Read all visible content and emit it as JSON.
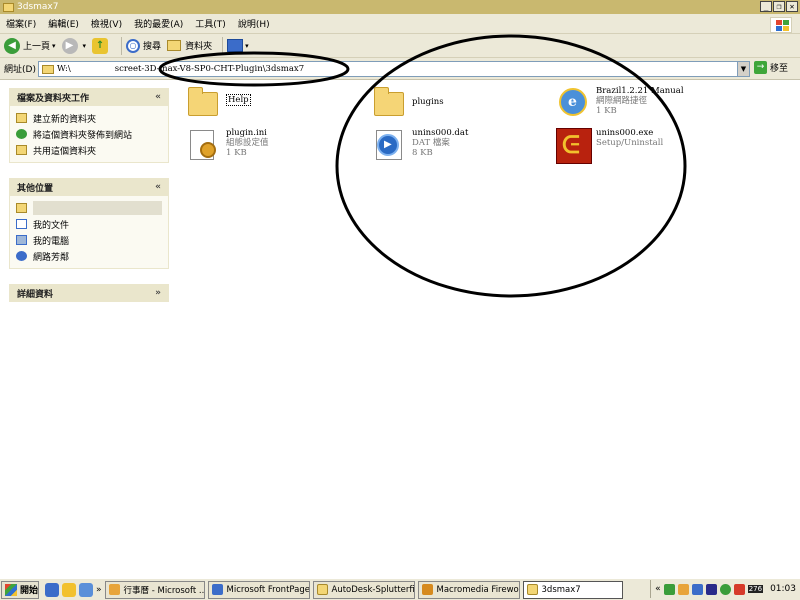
{
  "window": {
    "title": "3dsmax7"
  },
  "menu": [
    "檔案(F)",
    "編輯(E)",
    "檢視(V)",
    "我的最愛(A)",
    "工具(T)",
    "說明(H)"
  ],
  "toolbar": {
    "back": "上一頁",
    "search": "搜尋",
    "folders": "資料夾"
  },
  "address": {
    "label": "網址(D)",
    "drive": "W:\\",
    "path": "screet-3D-max-V8-SP0-CHT-Plugin\\3dsmax7",
    "go": "移至"
  },
  "sidebar": {
    "tasks": {
      "title": "檔案及資料夾工作",
      "items": [
        "建立新的資料夾",
        "將這個資料夾發佈到網站",
        "共用這個資料夾"
      ]
    },
    "places": {
      "title": "其他位置",
      "items": [
        "我的文件",
        "我的電腦",
        "網路芳鄰"
      ]
    },
    "details": {
      "title": "詳細資料"
    }
  },
  "files": [
    {
      "name": "Help",
      "type": "",
      "size": ""
    },
    {
      "name": "plugins",
      "type": "",
      "size": ""
    },
    {
      "name": "Brazil1.2.21 Manual",
      "type": "網際網路捷徑",
      "size": "1 KB"
    },
    {
      "name": "plugin.ini",
      "type": "組態設定值",
      "size": "1 KB"
    },
    {
      "name": "unins000.dat",
      "type": "DAT 檔案",
      "size": "8 KB"
    },
    {
      "name": "unins000.exe",
      "type": "Setup/Uninstall",
      "size": ""
    }
  ],
  "taskbar": {
    "start": "開始",
    "buttons": [
      "行事曆 - Microsoft ...",
      "Microsoft FrontPage...",
      "AutoDesk-Splutterfi...",
      "Macromedia Firewo...",
      "3dsmax7"
    ],
    "tray_badge": "276",
    "clock": "01:03"
  }
}
